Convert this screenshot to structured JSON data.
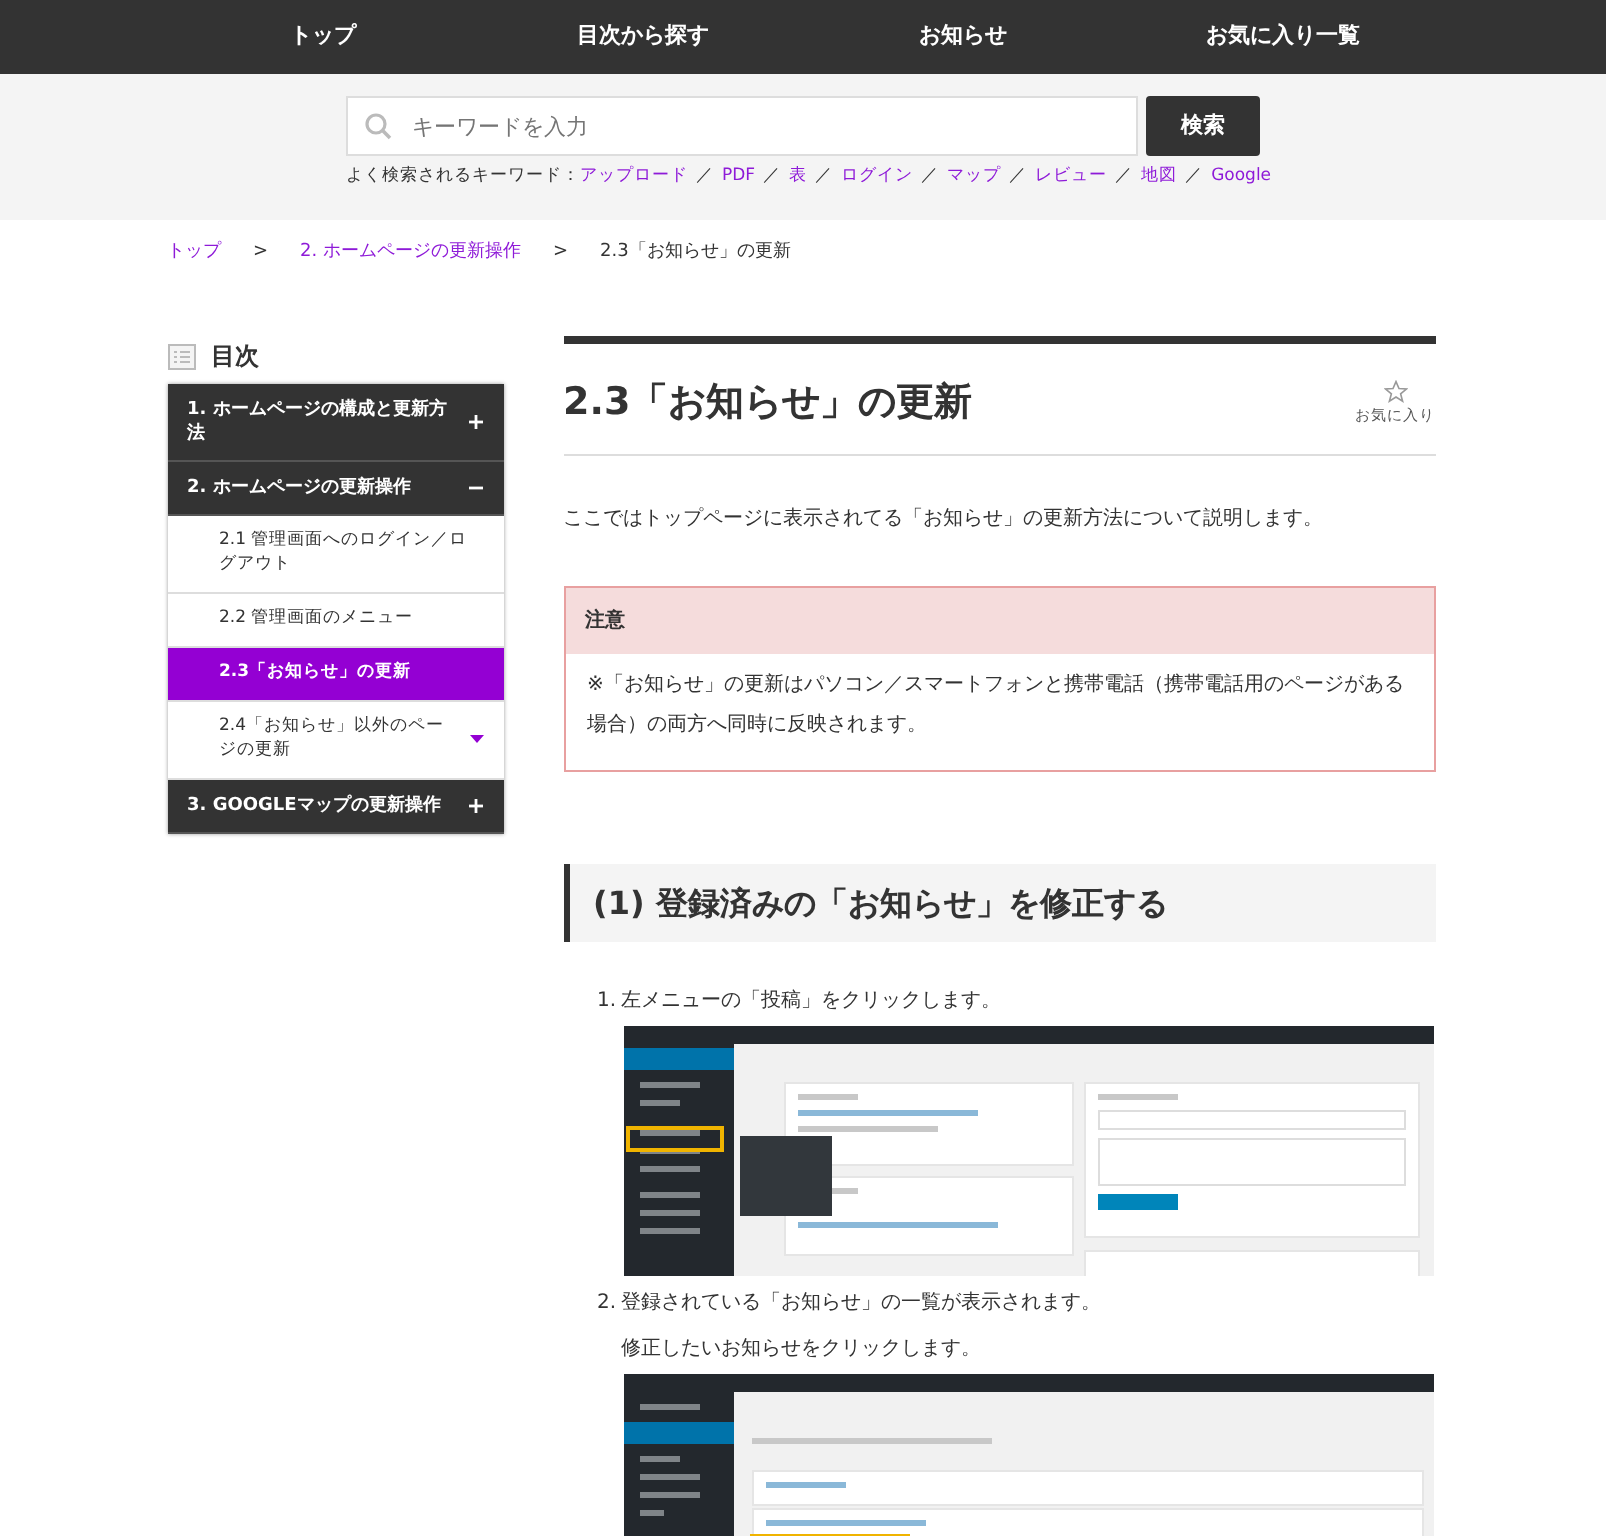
{
  "nav": [
    {
      "label": "トップ"
    },
    {
      "label": "目次から探す"
    },
    {
      "label": "お知らせ"
    },
    {
      "label": "お気に入り一覧"
    }
  ],
  "search": {
    "placeholder": "キーワードを入力",
    "button": "検索"
  },
  "keywords": {
    "label": "よく検索されるキーワード：",
    "separator": "／",
    "items": [
      "アップロード",
      "PDF",
      "表",
      "ログイン",
      "マップ",
      "レビュー",
      "地図",
      "Google"
    ]
  },
  "breadcrumb": {
    "separator": ">",
    "items": [
      {
        "label": "トップ",
        "current": false
      },
      {
        "label": "2. ホームページの更新操作",
        "current": false
      },
      {
        "label": "2.3「お知らせ」の更新",
        "current": true
      }
    ]
  },
  "toc": {
    "title": "目次",
    "sections": [
      {
        "label": "1. ホームページの構成と更新方法",
        "expanded": false
      },
      {
        "label": "2. ホームページの更新操作",
        "expanded": true,
        "children": [
          {
            "label": "2.1 管理画面へのログイン／ログアウト",
            "selected": false,
            "has_submenu": false
          },
          {
            "label": "2.2 管理画面のメニュー",
            "selected": false,
            "has_submenu": false
          },
          {
            "label": "2.3「お知らせ」の更新",
            "selected": true,
            "has_submenu": false
          },
          {
            "label": "2.4「お知らせ」以外のページの更新",
            "selected": false,
            "has_submenu": true
          }
        ]
      },
      {
        "label": "3. GOOGLEマップの更新操作",
        "expanded": false
      }
    ]
  },
  "article": {
    "title": "2.3「お知らせ」の更新",
    "favorite": {
      "label": "お気に入り",
      "on": false
    },
    "intro": "ここではトップページに表示されてる「お知らせ」の更新方法について説明します。",
    "notice": {
      "title": "注意",
      "body": "※「お知らせ」の更新はパソコン／スマートフォンと携帯電話（携帯電話用のページがある場合）の両方へ同時に反映されます。"
    },
    "section_heading": "(1) 登録済みの「お知らせ」を修正する",
    "steps": [
      {
        "number": "1.",
        "lines": [
          "左メニューの「投稿」をクリックします。"
        ],
        "screenshot": {
          "kind": "dashboard"
        }
      },
      {
        "number": "2.",
        "lines": [
          "登録されている「お知らせ」の一覧が表示されます。",
          "修正したいお知らせをクリックします。"
        ],
        "screenshot": {
          "kind": "posts-list"
        }
      }
    ]
  }
}
